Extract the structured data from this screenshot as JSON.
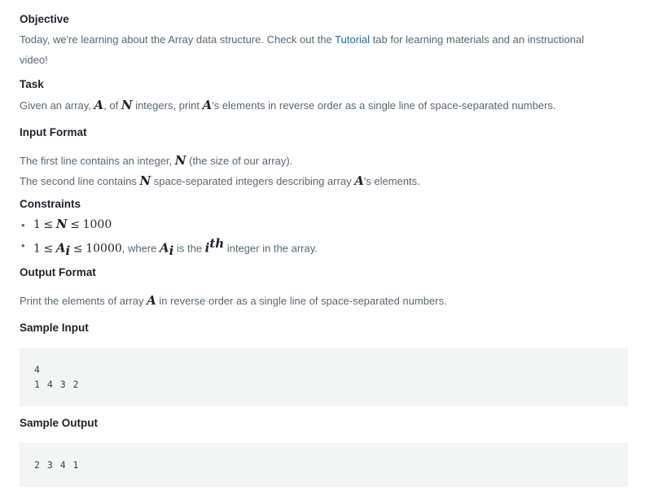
{
  "objective": {
    "heading": "Objective",
    "line1_pre": "Today, we're learning about the Array data structure. Check out the ",
    "link": "Tutorial",
    "line1_post": " tab for learning materials and an instructional",
    "line2": "video!"
  },
  "task": {
    "heading": "Task",
    "t1": "Given an array, ",
    "t2": ", of ",
    "t3": " integers, print ",
    "t4": "'s elements in reverse order as a single line of space-separated numbers."
  },
  "input_format": {
    "heading": "Input Format",
    "l1_a": "The first line contains an integer, ",
    "l1_b": " (the size of our array).",
    "l2_a": "The second line contains ",
    "l2_b": " space-separated integers describing array ",
    "l2_c": "'s elements."
  },
  "constraints": {
    "heading": "Constraints",
    "c2_where": ", where ",
    "c2_isthe": " is the ",
    "c2_tail": " integer in the array."
  },
  "math": {
    "A": "A",
    "N": "N",
    "one": "1",
    "le": "≤",
    "n1000": "1000",
    "n10000": "10000",
    "i": "i",
    "th": "th"
  },
  "output_format": {
    "heading": "Output Format",
    "p1": "Print the elements of array ",
    "p2": " in reverse order as a single line of space-separated numbers."
  },
  "sample_input": {
    "heading": "Sample Input",
    "code": "4\n1 4 3 2"
  },
  "sample_output": {
    "heading": "Sample Output",
    "code": "2 3 4 1"
  }
}
